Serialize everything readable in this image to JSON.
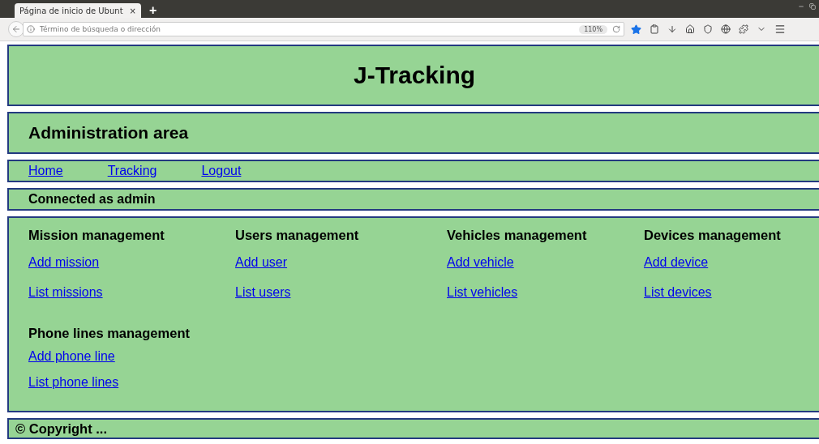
{
  "browser": {
    "tab_title": "Página de inicio de Ubunt",
    "tab_close": "×",
    "new_tab": "+",
    "address_placeholder": "Término de búsqueda o dirección",
    "zoom": "110%"
  },
  "header": {
    "title": "J-Tracking"
  },
  "subheader": {
    "title": "Administration area"
  },
  "nav": [
    "Home",
    "Tracking",
    "Logout"
  ],
  "status": "Connected as admin",
  "sections": [
    {
      "title": "Mission management",
      "links": [
        "Add mission",
        "List missions"
      ]
    },
    {
      "title": "Users management",
      "links": [
        "Add user",
        "List users"
      ]
    },
    {
      "title": "Vehicles management",
      "links": [
        "Add vehicle",
        "List vehicles"
      ]
    },
    {
      "title": "Devices management",
      "links": [
        "Add device",
        "List devices"
      ]
    },
    {
      "title": "Phone lines management",
      "links": [
        "Add phone line",
        "List phone lines"
      ]
    }
  ],
  "footer": "© Copyright ..."
}
